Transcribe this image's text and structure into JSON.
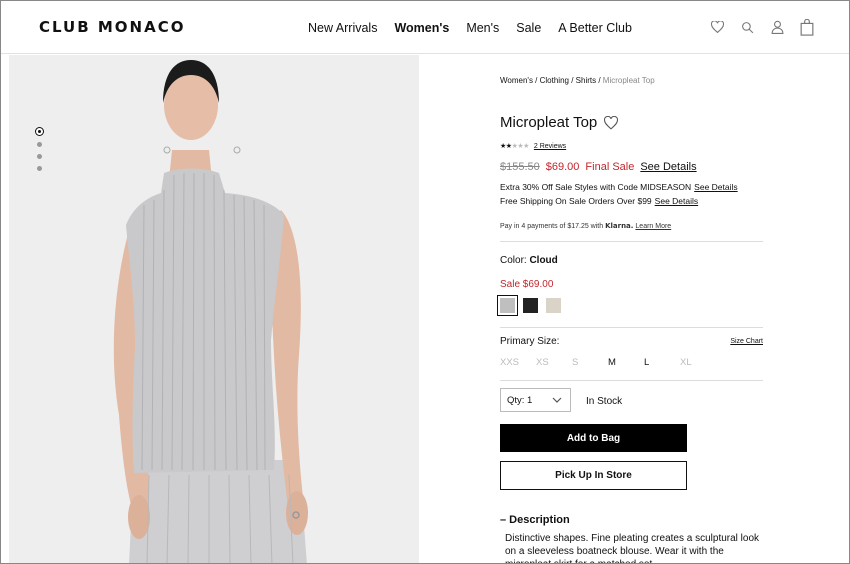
{
  "header": {
    "logo": "CLUB MONACO",
    "nav": [
      "New Arrivals",
      "Women's",
      "Men's",
      "Sale",
      "A Better Club"
    ],
    "active_nav": "Women's",
    "icons": [
      "heart-icon",
      "search-icon",
      "user-icon",
      "bag-icon"
    ]
  },
  "gallery": {
    "dot_count": 4,
    "active_dot": 0
  },
  "product": {
    "breadcrumb": {
      "items": [
        "Women's",
        "Clothing",
        "Shirts"
      ],
      "current": "Micropleat Top",
      "separator": " / "
    },
    "title": "Micropleat Top",
    "rating": 2,
    "rating_max": 5,
    "reviews_label": "2 Reviews",
    "original_price": "$155.50",
    "sale_price": "$69.00",
    "final_sale_label": "Final Sale",
    "see_details_label": "See Details",
    "promo_1": "Extra 30% Off Sale Styles with Code MIDSEASON",
    "promo_2": "Free Shipping On Sale Orders Over $99",
    "klarna_prefix": "Pay in 4 payments of $17.25 with",
    "klarna_brand": "Klarna.",
    "klarna_link": "Learn More",
    "color_label": "Color: ",
    "color_value": "Cloud",
    "sale_label": "Sale $69.00",
    "swatches": [
      "#bfbfbf",
      "#222222",
      "#d9d3c8"
    ],
    "selected_swatch": 0,
    "size_label": "Primary Size:",
    "size_chart_label": "Size Chart",
    "sizes": [
      {
        "label": "XXS",
        "available": false
      },
      {
        "label": "XS",
        "available": false
      },
      {
        "label": "S",
        "available": false
      },
      {
        "label": "M",
        "available": true
      },
      {
        "label": "L",
        "available": true
      },
      {
        "label": "XL",
        "available": false
      }
    ],
    "qty_label": "Qty: 1",
    "stock_label": "In Stock",
    "add_to_bag_label": "Add to Bag",
    "pick_up_label": "Pick Up In Store",
    "description_heading": "– Description",
    "description_text": "Distinctive shapes. Fine pleating creates a sculptural look on a sleeveless boatneck blouse. Wear it with the micropleat skirt for a matched set."
  },
  "colors": {
    "sale_red": "#c0272d",
    "image_bg": "#eeeeee",
    "button_black": "#000000"
  }
}
